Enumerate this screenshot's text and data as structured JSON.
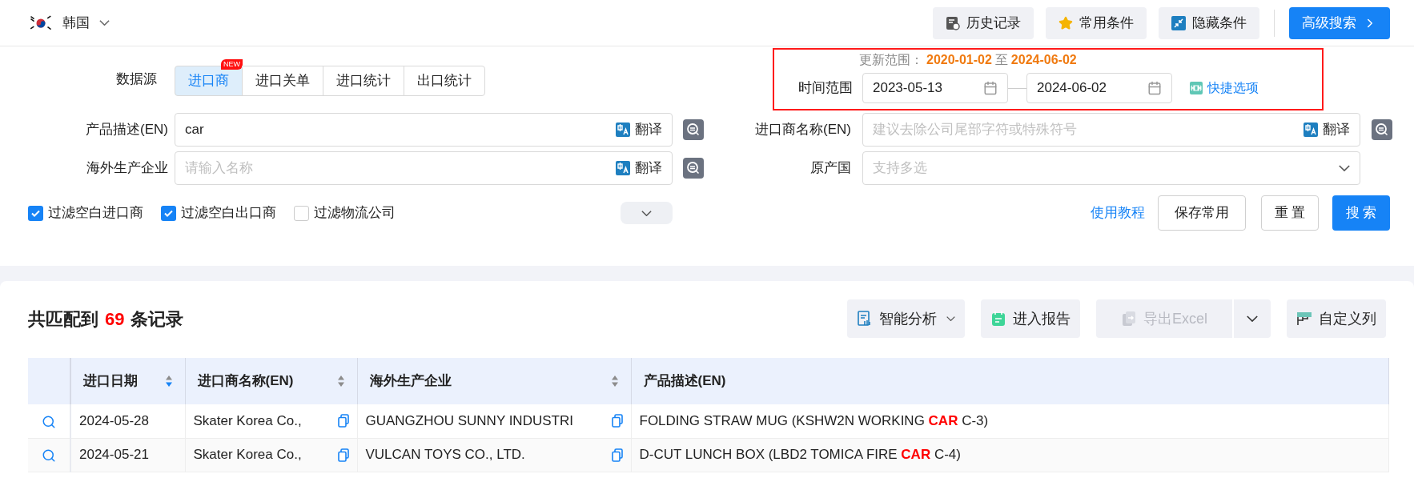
{
  "header": {
    "country": "韩国",
    "buttons": [
      {
        "label": "历史记录",
        "kind": "history"
      },
      {
        "label": "常用条件",
        "kind": "star"
      },
      {
        "label": "隐藏条件",
        "kind": "collapse"
      }
    ],
    "advanced": "高级搜索"
  },
  "source": {
    "label": "数据源",
    "tabs": [
      {
        "label": "进口商",
        "selected": true,
        "badge": "NEW"
      },
      {
        "label": "进口关单",
        "selected": false
      },
      {
        "label": "进口统计",
        "selected": false
      },
      {
        "label": "出口统计",
        "selected": false
      }
    ]
  },
  "time": {
    "range_label": "更新范围：",
    "range_from": "2020-01-02",
    "range_sep": "至",
    "range_to": "2024-06-02",
    "label": "时间范围",
    "from": "2023-05-13",
    "to": "2024-06-02",
    "shortcut": "快捷选项"
  },
  "fields_left": [
    {
      "label": "产品描述(EN)",
      "kind": "text",
      "value": "car",
      "translate": "翻译"
    },
    {
      "label": "海外生产企业",
      "kind": "text",
      "placeholder": "请输入名称",
      "translate": "翻译"
    }
  ],
  "fields_right": [
    {
      "label": "进口商名称(EN)",
      "kind": "text",
      "placeholder": "建议去除公司尾部字符或特殊符号",
      "translate": "翻译"
    },
    {
      "label": "原产国",
      "kind": "select",
      "placeholder": "支持多选"
    }
  ],
  "filters": [
    {
      "label": "过滤空白进口商",
      "checked": true
    },
    {
      "label": "过滤空白出口商",
      "checked": true
    },
    {
      "label": "过滤物流公司",
      "checked": false
    }
  ],
  "actions": {
    "tutorial": "使用教程",
    "save": "保存常用",
    "reset": "重 置",
    "search": "搜 索"
  },
  "results": {
    "prefix": "共匹配到",
    "count": "69",
    "suffix": "条记录",
    "tools": [
      {
        "label": "智能分析",
        "kind": "analysis",
        "disabled": false
      },
      {
        "label": "进入报告",
        "kind": "report",
        "disabled": false
      },
      {
        "label": "导出Excel",
        "kind": "export",
        "disabled": true
      },
      {
        "label": "自定义列",
        "kind": "columns",
        "disabled": false
      }
    ]
  },
  "table": {
    "columns": [
      {
        "label": "进口日期",
        "sorted": true
      },
      {
        "label": "进口商名称(EN)",
        "sorted": false
      },
      {
        "label": "海外生产企业",
        "sorted": false
      },
      {
        "label": "产品描述(EN)"
      }
    ],
    "rows": [
      [
        "2024-05-28",
        "Skater Korea Co.,",
        "GUANGZHOU SUNNY INDUSTRI",
        "FOLDING STRAW MUG (KSHW2N WORKING **CAR** C-3)"
      ],
      [
        "2024-05-21",
        "Skater Korea Co.,",
        "VULCAN TOYS CO., LTD.",
        "D-CUT LUNCH BOX (LBD2 TOMICA FIRE **CAR** C-4)"
      ]
    ]
  }
}
